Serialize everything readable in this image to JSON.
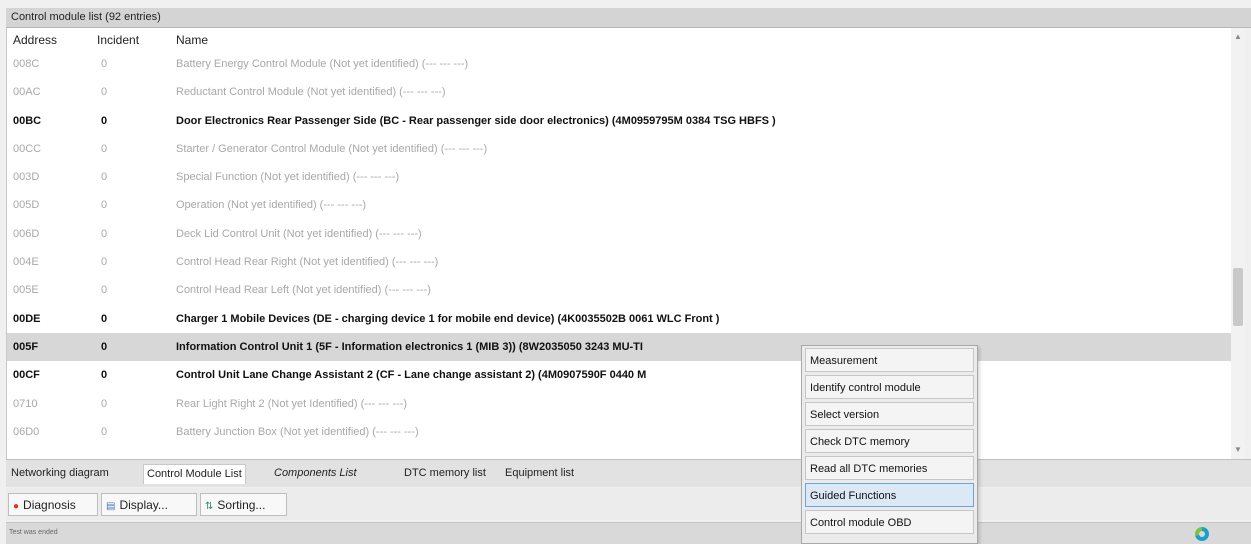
{
  "window": {
    "title": "Control module list (92 entries)"
  },
  "list": {
    "columns": {
      "address": "Address",
      "incident": "Incident",
      "name": "Name"
    },
    "rows": [
      {
        "address": "008C",
        "incident": "0",
        "name": "Battery Energy Control Module (Not yet identified) (---   ---   ---)",
        "style": "gray"
      },
      {
        "address": "00AC",
        "incident": "0",
        "name": "Reductant Control Module (Not yet identified) (---   ---   ---)",
        "style": "gray"
      },
      {
        "address": "00BC",
        "incident": "0",
        "name": "Door Electronics Rear Passenger Side (BC - Rear passenger side door electronics) (4M0959795M    0384   TSG HBFS    )",
        "style": "bold"
      },
      {
        "address": "00CC",
        "incident": "0",
        "name": "Starter / Generator Control Module (Not yet identified) (---   ---   ---)",
        "style": "gray"
      },
      {
        "address": "003D",
        "incident": "0",
        "name": "Special Function (Not yet identified) (---   ---   ---)",
        "style": "gray"
      },
      {
        "address": "005D",
        "incident": "0",
        "name": "Operation (Not yet identified) (---   ---   ---)",
        "style": "gray"
      },
      {
        "address": "006D",
        "incident": "0",
        "name": "Deck Lid Control Unit (Not yet identified) (---   ---   ---)",
        "style": "gray"
      },
      {
        "address": "004E",
        "incident": "0",
        "name": "Control Head Rear Right (Not yet identified) (---   ---   ---)",
        "style": "gray"
      },
      {
        "address": "005E",
        "incident": "0",
        "name": "Control Head Rear Left (Not yet identified) (---   ---   ---)",
        "style": "gray"
      },
      {
        "address": "00DE",
        "incident": "0",
        "name": "Charger 1 Mobile Devices (DE - charging device 1 for mobile end device) (4K0035502B    0061   WLC Front   )",
        "style": "bold"
      },
      {
        "address": "005F",
        "incident": "0",
        "name": "Information Control Unit 1 (5F - Information electronics 1 (MIB 3)) (8W2035050     3243   MU-TI",
        "style": "selected"
      },
      {
        "address": "00CF",
        "incident": "0",
        "name": "Control Unit Lane Change Assistant 2 (CF - Lane change assistant 2) (4M0907590F    0440   M",
        "style": "bold"
      },
      {
        "address": "0710",
        "incident": "0",
        "name": "Rear Light Right 2 (Not yet Identified) (---   ---   ---)",
        "style": "gray"
      },
      {
        "address": "06D0",
        "incident": "0",
        "name": "Battery Junction Box (Not yet identified) (---   ---   ---)",
        "style": "gray"
      }
    ]
  },
  "tabs": [
    {
      "label": "Networking diagram",
      "active": false,
      "italic": false
    },
    {
      "label": "Control Module List",
      "active": true,
      "italic": false
    },
    {
      "label": "Components List",
      "active": false,
      "italic": true
    },
    {
      "label": "DTC memory list",
      "active": false,
      "italic": false
    },
    {
      "label": "Equipment list",
      "active": false,
      "italic": false
    }
  ],
  "toolbar": {
    "diagnosis_label": "Diagnosis",
    "display_label": "Display...",
    "sorting_label": "Sorting..."
  },
  "status": {
    "text": "Test was ended"
  },
  "context_menu": {
    "items": [
      {
        "label": "Measurement",
        "highlighted": false
      },
      {
        "label": "Identify control module",
        "highlighted": false
      },
      {
        "label": "Select version",
        "highlighted": false
      },
      {
        "label": "Check DTC memory",
        "highlighted": false
      },
      {
        "label": "Read all DTC memories",
        "highlighted": false
      },
      {
        "label": "Guided Functions",
        "highlighted": true
      },
      {
        "label": "Control module OBD",
        "highlighted": false
      }
    ]
  },
  "colors": {
    "selected_row": "#d7d7d7",
    "menu_highlight_bg": "#dbe8f5",
    "menu_highlight_border": "#6fa4d8",
    "diagnosis_icon": "#d9342b",
    "display_icon": "#4a78c2",
    "sorting_icon": "#3b8a6e"
  },
  "icons": {
    "diagnosis": "red-dot-icon",
    "display": "display-window-icon",
    "sorting": "sorting-icon",
    "status": "progress-ring-icon"
  }
}
